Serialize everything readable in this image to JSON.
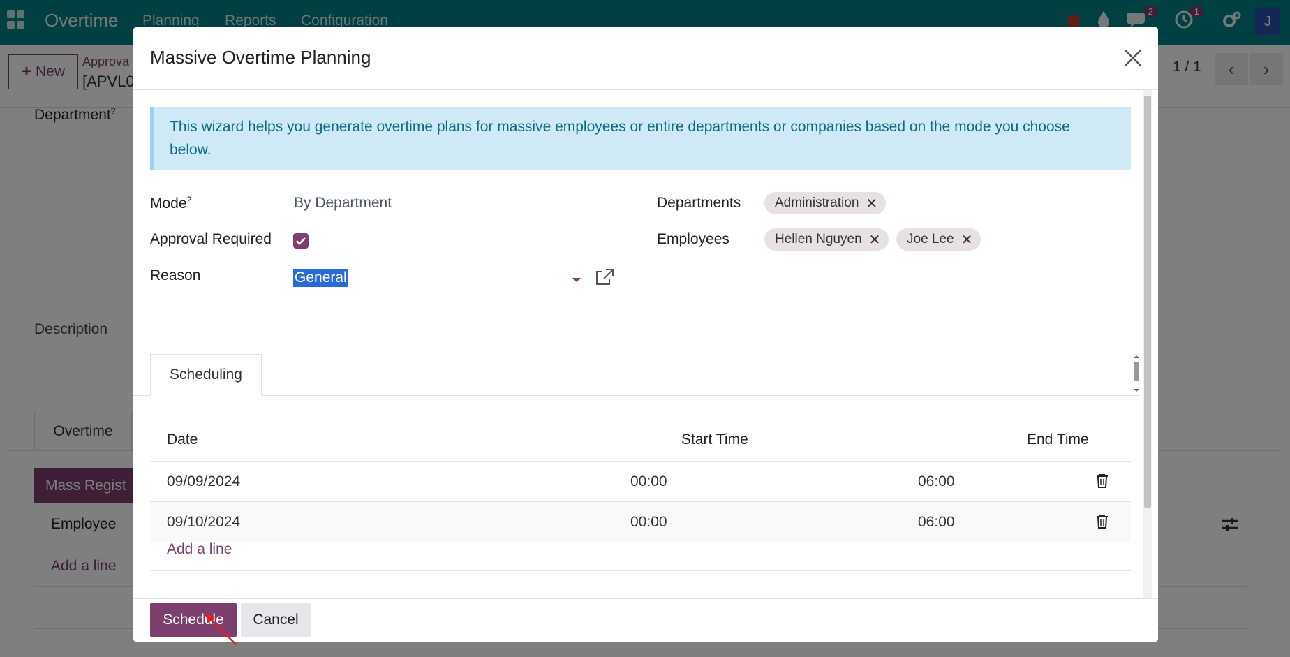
{
  "app": {
    "name": "Overtime",
    "menu": [
      "Planning",
      "Reports",
      "Configuration"
    ],
    "badges": {
      "messages": "2",
      "activities": "1"
    },
    "user_initial": "J",
    "brand_color": "#017e84",
    "accent_color": "#7c3f6e"
  },
  "control_panel": {
    "new_label": "New",
    "breadcrumb_parent": "Approva",
    "breadcrumb_current": "[APVL0",
    "pager": "1 / 1"
  },
  "background_form": {
    "department_label": "Department",
    "department_help": "?",
    "description_label": "Description",
    "tab_label": "Overtime",
    "mass_button": "Mass Regist",
    "employee_col": "Employee",
    "add_line": "Add a line"
  },
  "modal": {
    "title": "Massive Overtime Planning",
    "info": "This wizard helps you generate overtime plans for massive employees or entire departments or companies based on the mode you choose below.",
    "mode_label": "Mode",
    "mode_help": "?",
    "mode_value": "By Department",
    "approval_label": "Approval Required",
    "approval_checked": true,
    "reason_label": "Reason",
    "reason_value": "General",
    "departments_label": "Departments",
    "departments": [
      "Administration"
    ],
    "employees_label": "Employees",
    "employees": [
      "Hellen Nguyen",
      "Joe Lee"
    ],
    "tab": "Scheduling",
    "columns": {
      "date": "Date",
      "start": "Start Time",
      "end": "End Time"
    },
    "rows": [
      {
        "date": "09/09/2024",
        "start": "00:00",
        "end": "06:00"
      },
      {
        "date": "09/10/2024",
        "start": "00:00",
        "end": "06:00"
      }
    ],
    "add_line": "Add a line",
    "schedule_button": "Schedule",
    "cancel_button": "Cancel"
  }
}
